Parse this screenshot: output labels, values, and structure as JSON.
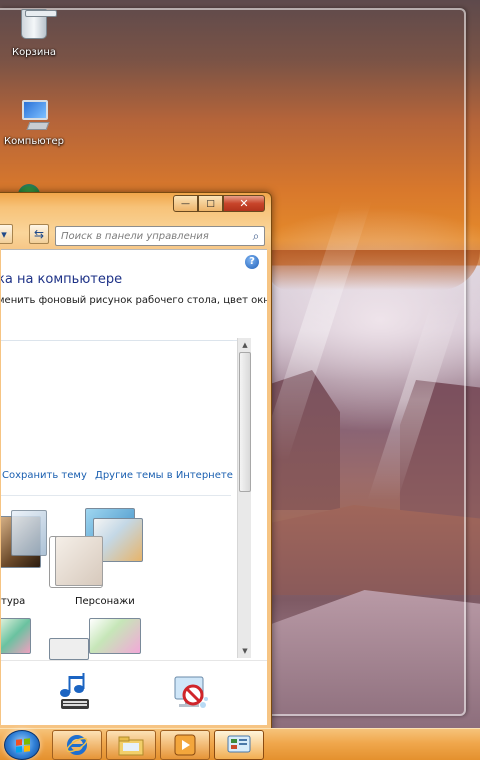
{
  "desktop": {
    "icons": [
      {
        "label": "Корзина",
        "icon": "recycle-bin-icon"
      },
      {
        "label": "Компьютер",
        "icon": "computer-icon"
      },
      {
        "label": "",
        "icon": "network-icon"
      }
    ]
  },
  "window": {
    "search_placeholder": "Поиск в панели управления",
    "heading": "ка на компьютере",
    "subtext": "менить фоновый рисунок рабочего стола, цвет окна,",
    "links": {
      "save_theme": "Сохранить тему",
      "more_themes": "Другие темы в Интернете"
    },
    "themes": [
      {
        "label": "ктура"
      },
      {
        "label": "Персонажи"
      }
    ],
    "caption_buttons": {
      "minimize": "—",
      "maximize": "□",
      "close": "✕"
    },
    "help": "?"
  },
  "taskbar": {
    "items": [
      {
        "icon": "start-orb-icon"
      },
      {
        "icon": "internet-explorer-icon"
      },
      {
        "icon": "windows-explorer-icon"
      },
      {
        "icon": "media-player-icon"
      },
      {
        "icon": "control-panel-icon"
      }
    ]
  },
  "colors": {
    "accent_orange": "#f0a74c",
    "link_blue": "#1a5fb0",
    "heading_blue": "#1e3287",
    "close_red": "#c8442a"
  }
}
